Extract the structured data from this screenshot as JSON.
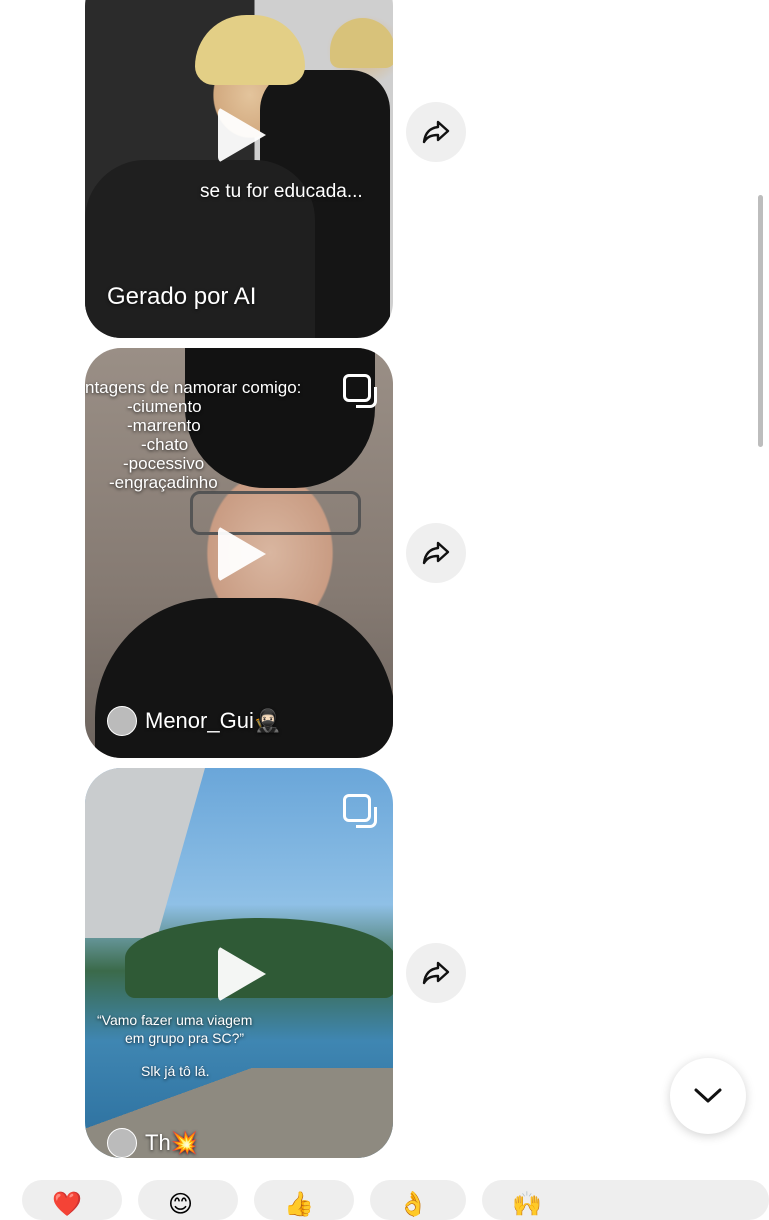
{
  "feed": {
    "items": [
      {
        "overlay_text": "se tu for educada...",
        "caption": "Gerado por AI"
      },
      {
        "overlay_lines": [
          "ntagens de namorar comigo:",
          "-ciumento",
          "-marrento",
          "-chato",
          "-pocessivo",
          "-engraçadinho"
        ],
        "author": "Menor_Gui🥷🏻"
      },
      {
        "overlay_lines": [
          "“Vamo fazer uma viagem",
          "em grupo pra SC?”",
          "Slk já tô lá."
        ],
        "author": "Th💥"
      }
    ]
  },
  "icons": {
    "play": "play-icon",
    "share": "share-icon",
    "multi": "multiple-clips-icon",
    "chevron": "chevron-down-icon"
  },
  "reactions": [
    "❤️",
    "😊",
    "👍",
    "👌",
    "🙌"
  ]
}
